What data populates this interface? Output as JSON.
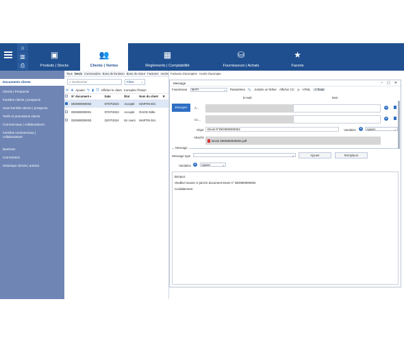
{
  "nav": {
    "modules": [
      {
        "label": "Produits | Stocks",
        "icon": "box-icon"
      },
      {
        "label": "Clients | Ventes",
        "icon": "users-icon"
      },
      {
        "label": "Règlements | Comptabilité",
        "icon": "calculator-icon"
      },
      {
        "label": "Fournisseurs | Achats",
        "icon": "basket-icon"
      },
      {
        "label": "Favoris",
        "icon": "star-icon"
      }
    ]
  },
  "sidebar": {
    "items": [
      "Documents clients",
      "Clients | Prospects",
      "Familles clients | prospects",
      "Sous-familles clients | prospects",
      "Tarifs et promotions clients",
      "Commerciaux | collaborateurs",
      "Familles commerciaux | collaborateurs",
      "Barèmes",
      "Commission",
      "Historique clients | articles"
    ]
  },
  "list": {
    "tabs": [
      "Tous",
      "Devis",
      "Commandes",
      "Bons de livraison",
      "Bons de retour",
      "Factures",
      "Avoirs",
      "Factures d'acomptes",
      "Avoirs d'acompte"
    ],
    "search_placeholder": "Rechercher",
    "filter_label": "Filtrer",
    "toolbar": {
      "add": "Ajouter",
      "show_client": "Afficher le client",
      "consult": "Consulter l'histori"
    },
    "columns": [
      "N° document",
      "Date",
      "État",
      "Nom du client",
      "R"
    ],
    "rows": [
      {
        "doc": "DE0900000002",
        "date": "07/07/2023",
        "etat": "Accepté",
        "client": "MARTIN Eric",
        "selected": true
      },
      {
        "doc": "DE0900000001",
        "date": "07/07/2023",
        "etat": "Accepté",
        "client": "RAVIN Odile",
        "selected": false
      },
      {
        "doc": "DE0900000003",
        "date": "22/07/2024",
        "etat": "En cours",
        "client": "MARTIN Eric",
        "selected": false
      }
    ]
  },
  "message": {
    "title": "Message",
    "fournisseur_label": "Fournisseur",
    "fournisseur_value": "MAPI",
    "parametres": "Paramètres",
    "joindre": "Joindre un fichier",
    "afficher_cc": "Afficher CC",
    "html": "HTML",
    "texte": "Texte",
    "email_header": "E-mail",
    "item_header": "Item",
    "send": "Envoyer",
    "to_label": "À...",
    "cc_label": "Cc...",
    "objet_label": "Objet",
    "objet_value": "Devis N°DE0900000002",
    "variables_label": "Variables",
    "ajouter": "Ajouter",
    "attache_label": "Attaché",
    "attachment": "Devis DE0900000002.pdf",
    "section_message": "Message",
    "message_type_label": "Message type",
    "btn_ajouter": "Ajouter",
    "btn_remplacer": "Remplacer",
    "body_lines": [
      "Bonjour,",
      "",
      "Veuillez trouver ci-joint le document Devis n° DE0900000002",
      "",
      "Cordialement"
    ]
  }
}
